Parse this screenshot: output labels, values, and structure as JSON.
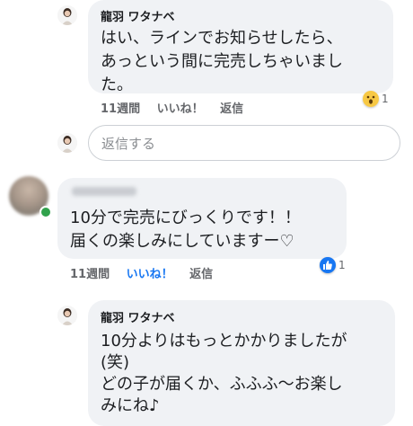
{
  "comments": [
    {
      "author": "龍羽 ワタナベ",
      "text_lines": [
        "はい、ラインでお知らせしたら、",
        "あっという間に完売しちゃいまし",
        "た。"
      ],
      "time": "11週間",
      "like_label": "いいね！",
      "reply_label": "返信",
      "reaction": {
        "icon": "wow-emoji-icon",
        "count": "1"
      }
    },
    {
      "author": "",
      "text_lines": [
        "10分で完売にびっくりです！！",
        "届くの楽しみにしていますー♡"
      ],
      "time": "11週間",
      "like_label": "いいね！",
      "reply_label": "返信",
      "reaction": {
        "icon": "like-thumb-icon",
        "count": "1"
      }
    },
    {
      "author": "龍羽 ワタナベ",
      "text_lines": [
        "10分よりはもっとかかりましたが",
        "(笑)",
        "どの子が届くか、ふふふ〜お楽し",
        "みにね♪"
      ]
    }
  ],
  "reply_box": {
    "placeholder": "返信する"
  },
  "colors": {
    "bubble": "#f0f2f5",
    "like_active": "#1877f2",
    "online": "#31a24c",
    "meta": "#65676b"
  }
}
